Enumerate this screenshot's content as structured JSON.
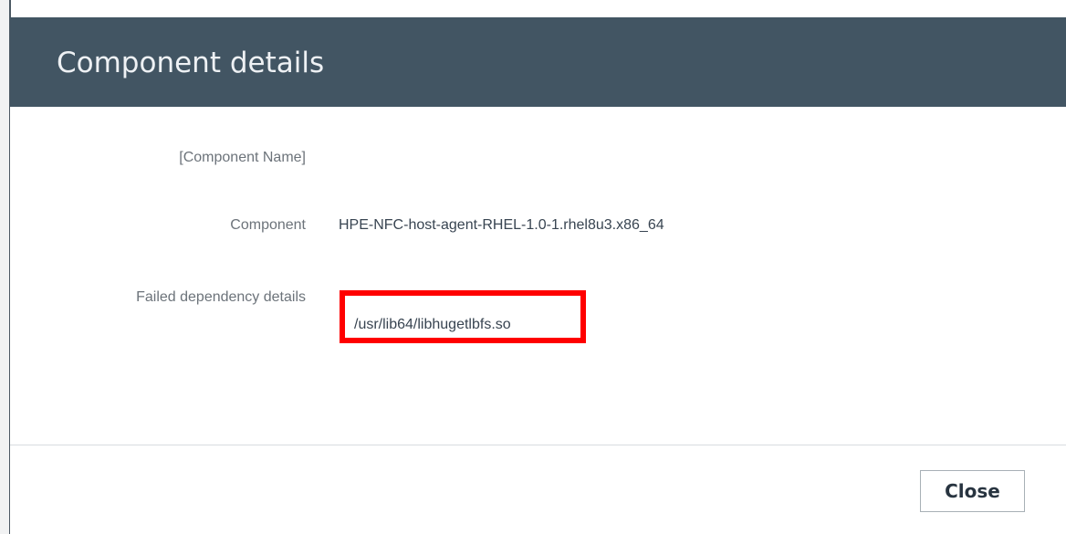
{
  "dialog": {
    "title": "Component details"
  },
  "details": {
    "component_name_placeholder": "[Component Name]",
    "component_label": "Component",
    "component_value": "HPE-NFC-host-agent-RHEL-1.0-1.rhel8u3.x86_64",
    "failed_dependency_label": "Failed dependency details",
    "failed_dependency_value": "/usr/lib64/libhugetlbfs.so"
  },
  "footer": {
    "close_label": "Close"
  },
  "colors": {
    "header_bg": "#425563",
    "highlight": "#ff0000"
  }
}
